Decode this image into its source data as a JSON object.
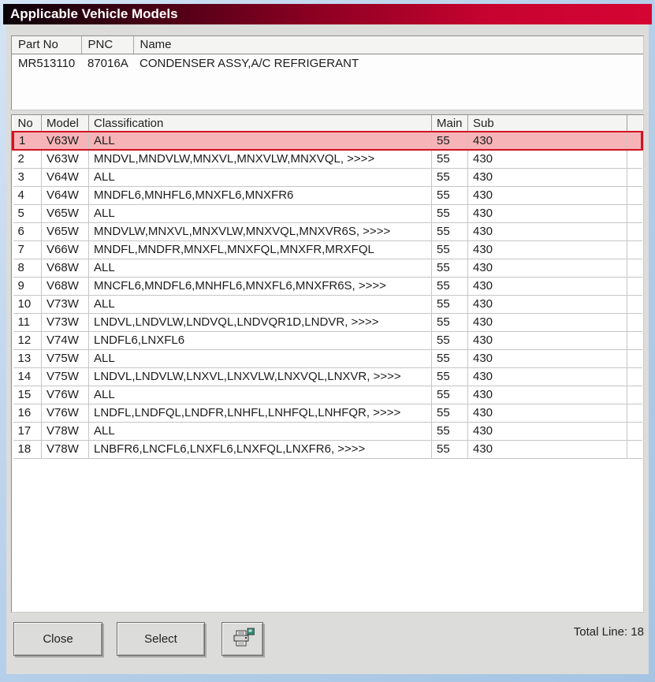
{
  "title": "Applicable Vehicle Models",
  "part_info": {
    "headers": {
      "part_no": "Part No",
      "pnc": "PNC",
      "name": "Name"
    },
    "row": {
      "part_no": "MR513110",
      "pnc": "87016A",
      "name": "CONDENSER ASSY,A/C REFRIGERANT"
    }
  },
  "models_table": {
    "headers": {
      "no": "No",
      "model": "Model",
      "classification": "Classification",
      "main": "Main",
      "sub": "Sub"
    },
    "selected_row_index": 0,
    "rows": [
      {
        "no": "1",
        "model": "V63W",
        "classification": "ALL",
        "main": "55",
        "sub": "430"
      },
      {
        "no": "2",
        "model": "V63W",
        "classification": "MNDVL,MNDVLW,MNXVL,MNXVLW,MNXVQL, >>>>",
        "main": "55",
        "sub": "430"
      },
      {
        "no": "3",
        "model": "V64W",
        "classification": "ALL",
        "main": "55",
        "sub": "430"
      },
      {
        "no": "4",
        "model": "V64W",
        "classification": "MNDFL6,MNHFL6,MNXFL6,MNXFR6",
        "main": "55",
        "sub": "430"
      },
      {
        "no": "5",
        "model": "V65W",
        "classification": "ALL",
        "main": "55",
        "sub": "430"
      },
      {
        "no": "6",
        "model": "V65W",
        "classification": "MNDVLW,MNXVL,MNXVLW,MNXVQL,MNXVR6S, >>>>",
        "main": "55",
        "sub": "430"
      },
      {
        "no": "7",
        "model": "V66W",
        "classification": "MNDFL,MNDFR,MNXFL,MNXFQL,MNXFR,MRXFQL",
        "main": "55",
        "sub": "430"
      },
      {
        "no": "8",
        "model": "V68W",
        "classification": "ALL",
        "main": "55",
        "sub": "430"
      },
      {
        "no": "9",
        "model": "V68W",
        "classification": "MNCFL6,MNDFL6,MNHFL6,MNXFL6,MNXFR6S, >>>>",
        "main": "55",
        "sub": "430"
      },
      {
        "no": "10",
        "model": "V73W",
        "classification": "ALL",
        "main": "55",
        "sub": "430"
      },
      {
        "no": "11",
        "model": "V73W",
        "classification": "LNDVL,LNDVLW,LNDVQL,LNDVQR1D,LNDVR, >>>>",
        "main": "55",
        "sub": "430"
      },
      {
        "no": "12",
        "model": "V74W",
        "classification": "LNDFL6,LNXFL6",
        "main": "55",
        "sub": "430"
      },
      {
        "no": "13",
        "model": "V75W",
        "classification": "ALL",
        "main": "55",
        "sub": "430"
      },
      {
        "no": "14",
        "model": "V75W",
        "classification": "LNDVL,LNDVLW,LNXVL,LNXVLW,LNXVQL,LNXVR, >>>>",
        "main": "55",
        "sub": "430"
      },
      {
        "no": "15",
        "model": "V76W",
        "classification": "ALL",
        "main": "55",
        "sub": "430"
      },
      {
        "no": "16",
        "model": "V76W",
        "classification": "LNDFL,LNDFQL,LNDFR,LNHFL,LNHFQL,LNHFQR, >>>>",
        "main": "55",
        "sub": "430"
      },
      {
        "no": "17",
        "model": "V78W",
        "classification": "ALL",
        "main": "55",
        "sub": "430"
      },
      {
        "no": "18",
        "model": "V78W",
        "classification": "LNBFR6,LNCFL6,LNXFL6,LNXFQL,LNXFR6, >>>>",
        "main": "55",
        "sub": "430"
      }
    ]
  },
  "footer": {
    "close_label": "Close",
    "select_label": "Select",
    "total_line_label": "Total Line: 18"
  },
  "colors": {
    "title_gradient_start": "#0a0008",
    "title_gradient_end": "#d50433",
    "selected_row_bg": "#f6b4b8",
    "selected_row_border": "#d01323",
    "frame_blue": "#b7d0ea",
    "panel_gray": "#dcdcda",
    "printer_icon_green": "#2e8b74"
  }
}
